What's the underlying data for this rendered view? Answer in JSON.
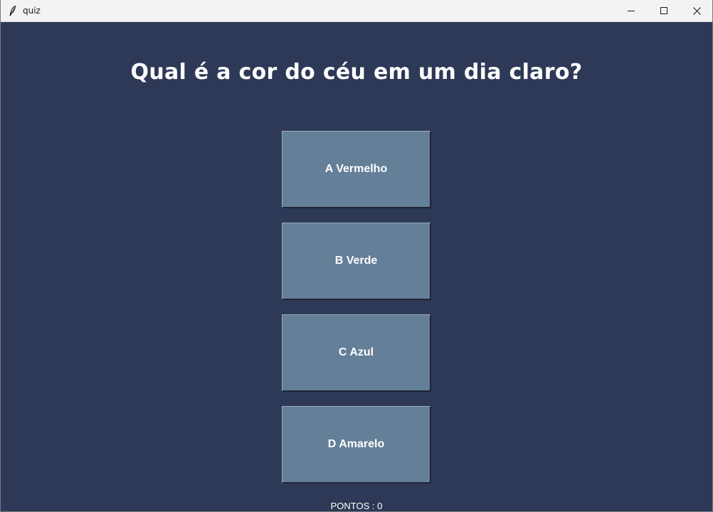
{
  "window": {
    "title": "quiz",
    "icon": "feather-icon",
    "controls": [
      "minimize-icon",
      "maximize-icon",
      "close-icon"
    ]
  },
  "quiz": {
    "question": "Qual é a cor do céu em um dia claro?",
    "answers": [
      {
        "label": "A Vermelho"
      },
      {
        "label": "B Verde"
      },
      {
        "label": "C Azul"
      },
      {
        "label": "D Amarelo"
      }
    ],
    "score_label": "PONTOS : 0"
  },
  "colors": {
    "background": "#2e3957",
    "button": "#647f98",
    "text": "#ffffff"
  }
}
